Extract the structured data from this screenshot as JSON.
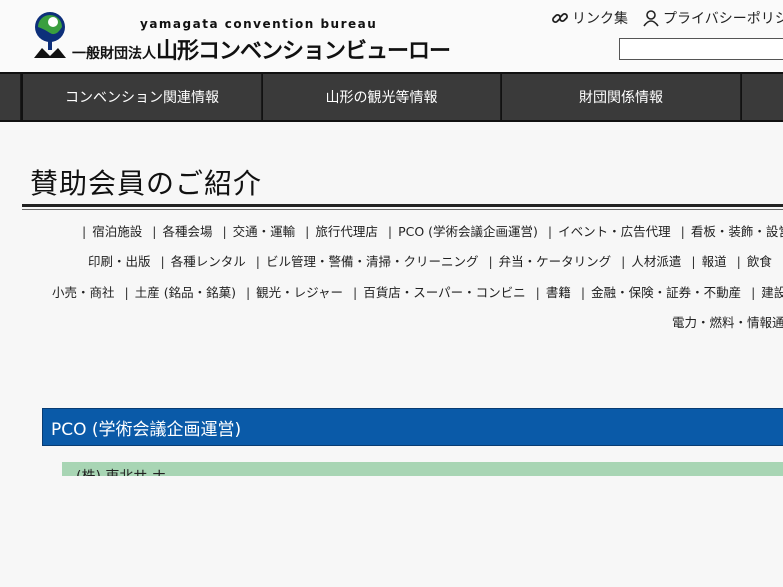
{
  "header": {
    "logo_en": "yamagata convention bureau",
    "logo_prefix": "一般財団法人",
    "logo_jp": "山形コンベンションビューロー",
    "links_label": "リンク集",
    "privacy_label": "プライバシーポリシ",
    "search_placeholder": ""
  },
  "nav": {
    "items": [
      {
        "label": "コンベンション関連情報"
      },
      {
        "label": "山形の観光等情報"
      },
      {
        "label": "財団関係情報"
      }
    ]
  },
  "page": {
    "title": "賛助会員のご紹介"
  },
  "categories": {
    "row1": [
      "宿泊施設",
      "各種会場",
      "交通・運輸",
      "旅行代理店",
      "PCO (学術会議企画運営)",
      "イベント・広告代理",
      "看板・装飾・設営"
    ],
    "row2": [
      "印刷・出版",
      "各種レンタル",
      "ビル管理・警備・清掃・クリーニング",
      "弁当・ケータリング",
      "人材派遣",
      "報道",
      "飲食"
    ],
    "row3": [
      "小売・商社",
      "土産 (銘品・銘菓)",
      "観光・レジャー",
      "百貨店・スーパー・コンビニ",
      "書籍",
      "金融・保険・証券・不動産",
      "建設"
    ],
    "row4": [
      "電力・燃料・情報通"
    ]
  },
  "section": {
    "heading": "PCO (学術会議企画運営)",
    "first_member": "(株) 東北サ ナ"
  },
  "colors": {
    "nav_bg": "#3a3a3a",
    "section_blue": "#0a5aa8",
    "member_green": "#a8d5b4"
  }
}
